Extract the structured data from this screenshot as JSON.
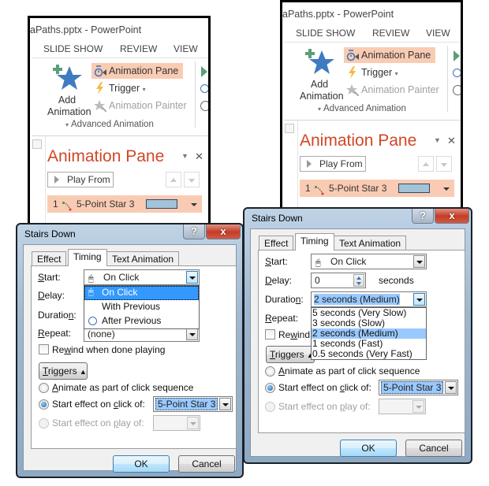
{
  "windows": [
    {
      "title": "aPaths.pptx - PowerPoint",
      "ribbon_tabs": [
        "SLIDE SHOW",
        "REVIEW",
        "VIEW"
      ],
      "add_animation": {
        "line1": "Add",
        "line2": "Animation",
        "icon": "star-plus-icon"
      },
      "buttons": {
        "animation_pane": "Animation Pane",
        "trigger": "Trigger",
        "animation_painter": "Animation Painter"
      },
      "group_label": "Advanced Animation",
      "pane": {
        "title": "Animation Pane",
        "play_from": "Play From",
        "item": {
          "number": "1",
          "name": "5-Point Star 3",
          "bar_color": "#a2c3d8"
        }
      }
    },
    {
      "title": "aPaths.pptx - PowerPoint",
      "ribbon_tabs": [
        "SLIDE SHOW",
        "REVIEW",
        "VIEW"
      ],
      "add_animation": {
        "line1": "Add",
        "line2": "Animation",
        "icon": "star-plus-icon"
      },
      "buttons": {
        "animation_pane": "Animation Pane",
        "trigger": "Trigger",
        "animation_painter": "Animation Painter"
      },
      "group_label": "Advanced Animation",
      "pane": {
        "title": "Animation Pane",
        "play_from": "Play From",
        "item": {
          "number": "1",
          "name": "5-Point Star 3",
          "bar_color": "#a2c3d8"
        }
      }
    }
  ],
  "dialogs": [
    {
      "title": "Stairs Down",
      "help": "?",
      "close": "x",
      "tabs": [
        "Effect",
        "Timing",
        "Text Animation"
      ],
      "selected_tab": "Timing",
      "labels": {
        "start": "tart:",
        "start_u": "S",
        "delay": "elay:",
        "delay_u": "D",
        "duration": "Duratio",
        "duration_u": "n",
        "duration_end": ":",
        "repeat": "epeat:",
        "repeat_u": "R"
      },
      "start_value": "On Click",
      "start_options": [
        {
          "label": "On Click",
          "icon": "mouse-click-icon",
          "selected": true
        },
        {
          "label": "With Previous",
          "icon": "",
          "selected": false
        },
        {
          "label": "After Previous",
          "icon": "clock-icon",
          "selected": false
        }
      ],
      "repeat_value": "(none)",
      "rewind": {
        "pre": "Re",
        "u": "w",
        "post": "ind when done playing",
        "checked": false
      },
      "triggers_label": "riggers",
      "triggers_u": "T",
      "radio_animate": {
        "u": "A",
        "post": "nimate as part of click sequence",
        "checked": false
      },
      "radio_click": {
        "pre": "Start effect on ",
        "u": "c",
        "post": "lick of:",
        "checked": true,
        "value": "5-Point Star 3"
      },
      "radio_play": {
        "pre": "Start effect on ",
        "u": "p",
        "post": "lay of:",
        "checked": false,
        "disabled": true
      },
      "ok": "OK",
      "cancel": "Cancel"
    },
    {
      "title": "Stairs Down",
      "help": "?",
      "close": "x",
      "tabs": [
        "Effect",
        "Timing",
        "Text Animation"
      ],
      "selected_tab": "Timing",
      "labels": {
        "start": "tart:",
        "start_u": "S",
        "delay": "elay:",
        "delay_u": "D",
        "duration": "Duratio",
        "duration_u": "n",
        "duration_end": ":",
        "repeat": "epeat:",
        "repeat_u": "R"
      },
      "start_value": "On Click",
      "delay_value": "0",
      "delay_unit": "seconds",
      "duration_value": "2 seconds (Medium)",
      "duration_options": [
        {
          "label": "5 seconds (Very Slow)",
          "selected": false
        },
        {
          "label": "3 seconds (Slow)",
          "selected": false
        },
        {
          "label": "2 seconds (Medium)",
          "selected": true
        },
        {
          "label": "1 seconds (Fast)",
          "selected": false
        },
        {
          "label": "0.5 seconds (Very Fast)",
          "selected": false
        }
      ],
      "rewind": {
        "pre": "Re",
        "u": "w",
        "post": "ind",
        "checked": false
      },
      "triggers_label": "riggers",
      "triggers_u": "T",
      "radio_animate": {
        "u": "A",
        "post": "nimate as part of click sequence",
        "checked": false
      },
      "radio_click": {
        "pre": "Start effect on ",
        "u": "c",
        "post": "lick of:",
        "checked": true,
        "value": "5-Point Star 3"
      },
      "radio_play": {
        "pre": "Start effect on ",
        "u": "p",
        "post": "lay of:",
        "checked": false,
        "disabled": true
      },
      "ok": "OK",
      "cancel": "Cancel"
    }
  ],
  "colors": {
    "accent_orange": "#d24726",
    "highlight": "#f9cbb3",
    "selection_blue": "#3399ff",
    "selection_light": "#99c9ff"
  }
}
